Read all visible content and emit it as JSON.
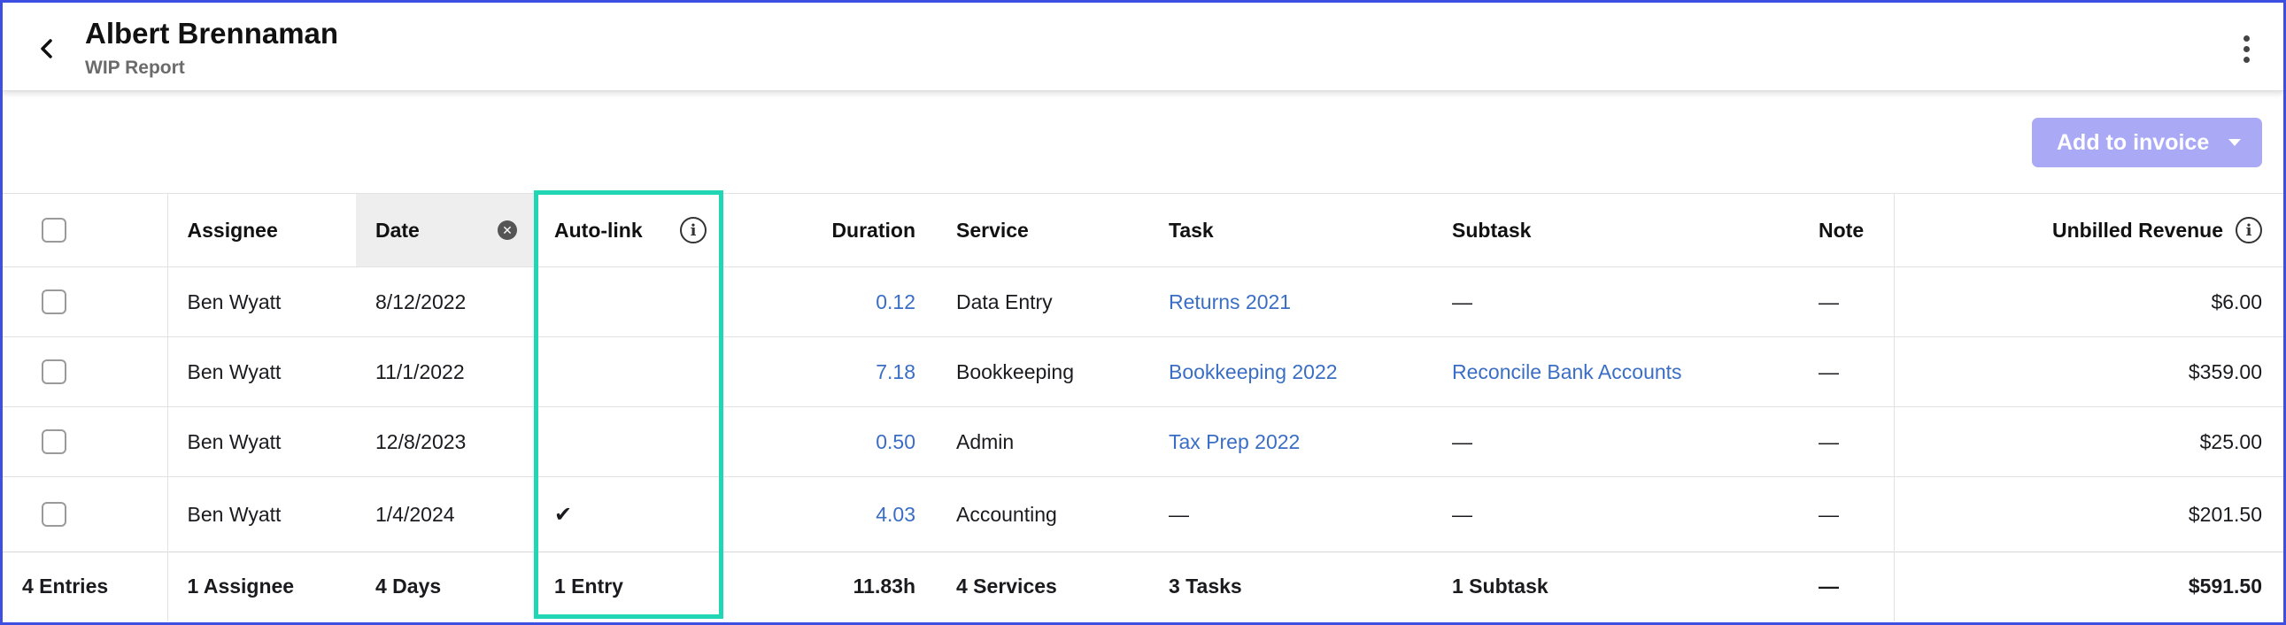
{
  "header": {
    "title": "Albert Brennaman",
    "subtitle": "WIP Report"
  },
  "toolbar": {
    "add_to_invoice_label": "Add to invoice"
  },
  "table": {
    "columns": {
      "assignee": "Assignee",
      "date": "Date",
      "auto_link": "Auto-link",
      "duration": "Duration",
      "service": "Service",
      "task": "Task",
      "subtask": "Subtask",
      "note": "Note",
      "unbilled_revenue": "Unbilled Revenue"
    },
    "rows": [
      {
        "assignee": "Ben Wyatt",
        "date": "8/12/2022",
        "auto_link": "",
        "duration": "0.12",
        "service": "Data Entry",
        "task": "Returns 2021",
        "subtask": "—",
        "note": "—",
        "unbilled_revenue": "$6.00"
      },
      {
        "assignee": "Ben Wyatt",
        "date": "11/1/2022",
        "auto_link": "",
        "duration": "7.18",
        "service": "Bookkeeping",
        "task": "Bookkeeping 2022",
        "subtask": "Reconcile Bank Accounts",
        "note": "—",
        "unbilled_revenue": "$359.00"
      },
      {
        "assignee": "Ben Wyatt",
        "date": "12/8/2023",
        "auto_link": "",
        "duration": "0.50",
        "service": "Admin",
        "task": "Tax Prep 2022",
        "subtask": "—",
        "note": "—",
        "unbilled_revenue": "$25.00"
      },
      {
        "assignee": "Ben Wyatt",
        "date": "1/4/2024",
        "auto_link": "✔",
        "duration": "4.03",
        "service": "Accounting",
        "task": "—",
        "subtask": "—",
        "note": "—",
        "unbilled_revenue": "$201.50"
      }
    ],
    "footer": {
      "entries": "4 Entries",
      "assignee": "1 Assignee",
      "date": "4 Days",
      "auto_link": "1 Entry",
      "duration": "11.83h",
      "service": "4 Services",
      "task": "3 Tasks",
      "subtask": "1 Subtask",
      "note": "—",
      "unbilled_revenue": "$591.50"
    }
  },
  "colors": {
    "accent_border": "#3d4fe0",
    "highlight": "#21d6b4",
    "link": "#3a6ec5",
    "button_disabled": "#a9a9f6"
  },
  "icons": [
    "back-arrow-icon",
    "more-vertical-icon",
    "caret-down-icon",
    "clear-icon",
    "info-icon",
    "checkmark-icon"
  ]
}
